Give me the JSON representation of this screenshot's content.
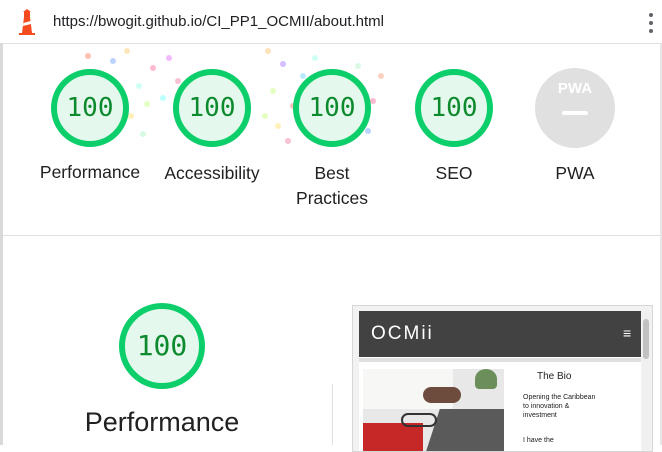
{
  "browser": {
    "url": "https://bwogit.github.io/CI_PP1_OCMII/about.html"
  },
  "colors": {
    "pass_green": "#0cce6b",
    "pass_fill": "#e5f8ed",
    "score_text": "#0d8a2e",
    "pwa_gray": "#e0e0e0"
  },
  "categories": [
    {
      "label": "Performance",
      "score": "100"
    },
    {
      "label": "Accessibility",
      "score": "100"
    },
    {
      "label": "Best Practices",
      "score": "100"
    },
    {
      "label": "SEO",
      "score": "100"
    },
    {
      "label": "PWA",
      "badge": "PWA"
    }
  ],
  "performance_section": {
    "score": "100",
    "title": "Performance"
  },
  "screenshot": {
    "brand": "OCMii",
    "menu_icon": "hamburger-icon",
    "heading": "The Bio",
    "text": "Opening the Caribbean to innovation & investment",
    "text2": "I have the"
  }
}
